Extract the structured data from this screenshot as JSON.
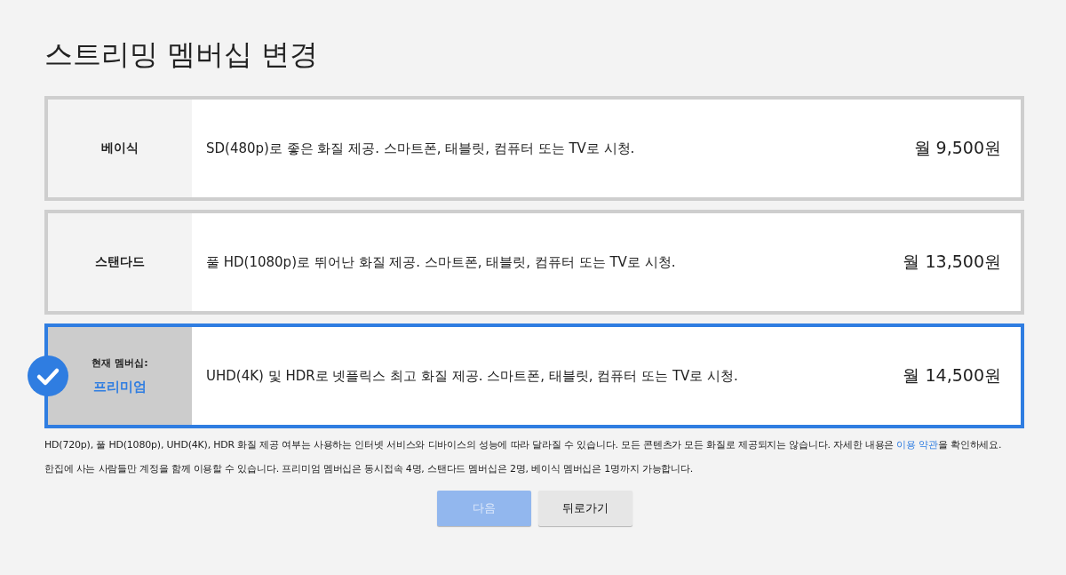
{
  "title": "스트리밍 멤버십 변경",
  "plans": [
    {
      "name": "베이식",
      "description": "SD(480p)로 좋은 화질 제공. 스마트폰, 태블릿, 컴퓨터 또는 TV로 시청.",
      "price": "월 9,500원",
      "selected": false
    },
    {
      "name": "스탠다드",
      "description": "풀 HD(1080p)로 뛰어난 화질 제공. 스마트폰, 태블릿, 컴퓨터 또는 TV로 시청.",
      "price": "월 13,500원",
      "selected": false
    },
    {
      "name": "프리미엄",
      "current_label": "현재 멤버십:",
      "description": "UHD(4K) 및 HDR로 넷플릭스 최고 화질 제공. 스마트폰, 태블릿, 컴퓨터 또는 TV로 시청.",
      "price": "월 14,500원",
      "selected": true
    }
  ],
  "notes": [
    {
      "text": "HD(720p), 풀 HD(1080p), UHD(4K), HDR 화질 제공 여부는 사용하는 인터넷 서비스와 디바이스의 성능에 따라 달라질 수 있습니다. 모든 콘텐츠가 모든 화질로 제공되지는 않습니다. 자세한 내용은 ",
      "link": "이용 약관",
      "after": "을 확인하세요."
    },
    {
      "text": "한집에 사는 사람들만 계정을 함께 이용할 수 있습니다. 프리미엄 멤버십은 동시접속 4명, 스탠다드 멤버십은 2명, 베이식 멤버십은 1명까지 가능합니다."
    }
  ],
  "buttons": [
    {
      "label": "다음",
      "kind": "primary",
      "disabled": true
    },
    {
      "label": "뒤로가기",
      "kind": "secondary",
      "disabled": false
    }
  ]
}
